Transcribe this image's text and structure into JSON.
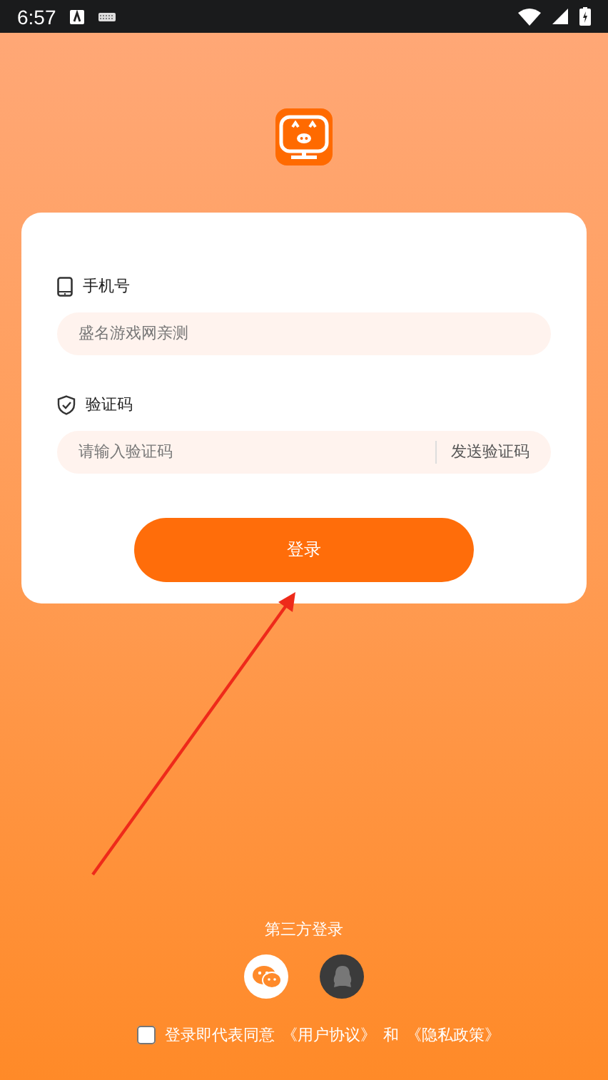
{
  "status_bar": {
    "time": "6:57"
  },
  "phone": {
    "label": "手机号",
    "placeholder": "盛名游戏网亲测"
  },
  "code": {
    "label": "验证码",
    "placeholder": "请输入验证码",
    "send_button": "发送验证码"
  },
  "login_button": "登录",
  "third_party": {
    "title": "第三方登录",
    "providers": [
      {
        "kind": "wechat"
      },
      {
        "kind": "qq"
      }
    ]
  },
  "agreement": {
    "checked": false,
    "text": "登录即代表同意",
    "links": [
      "《用户协议》",
      "《隐私政策》"
    ],
    "joiner": "和"
  }
}
